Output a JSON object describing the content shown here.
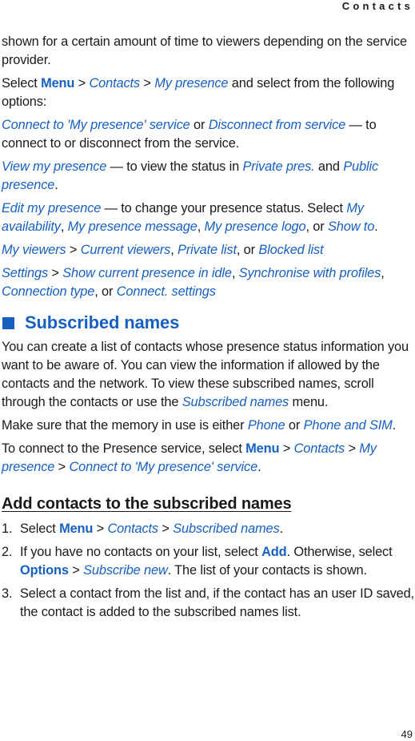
{
  "header": {
    "section_title": "Contacts"
  },
  "intro": {
    "continuation": "shown for a certain amount of time to viewers depending on the service provider.",
    "select_prefix": "Select ",
    "menu": "Menu",
    "sep": " > ",
    "contacts": "Contacts",
    "my_presence": "My presence",
    "select_suffix": " and select from the following options:"
  },
  "options": {
    "connect": {
      "opt1": "Connect to 'My presence' service",
      "or": " or ",
      "opt2": "Disconnect from service",
      "desc": " — to connect to or disconnect from the service."
    },
    "view": {
      "opt": "View my presence",
      "desc": " — to view the status in ",
      "private": "Private pres.",
      "and": " and ",
      "public": "Public presence",
      "end": "."
    },
    "edit": {
      "opt": "Edit my presence",
      "desc": " — to change your presence status. Select ",
      "a": "My availability",
      "comma1": ", ",
      "b": "My presence message",
      "comma2": ", ",
      "c": "My presence logo",
      "or": ", or ",
      "d": "Show to",
      "end": "."
    },
    "viewers": {
      "opt": "My viewers",
      "sep": " > ",
      "a": "Current viewers",
      "comma": ", ",
      "b": "Private list",
      "or": ", or ",
      "c": "Blocked list"
    },
    "settings": {
      "opt": "Settings",
      "sep": " > ",
      "a": "Show current presence in idle",
      "comma1": ", ",
      "b": "Synchronise with profiles",
      "comma2": ", ",
      "c": "Connection type",
      "or": ", or ",
      "d": "Connect. settings"
    }
  },
  "subscribed": {
    "heading": "Subscribed names",
    "para1_prefix": "You can create a list of contacts whose presence status information you want to be aware of. You can view the information if allowed by the contacts and the network. To view these subscribed names, scroll through the contacts or use the ",
    "para1_link": "Subscribed names",
    "para1_suffix": " menu.",
    "para2_prefix": "Make sure that the memory in use is either ",
    "para2_a": "Phone",
    "para2_or": " or ",
    "para2_b": "Phone and SIM",
    "para2_end": ".",
    "para3_prefix": "To connect to the Presence service, select ",
    "para3_menu": "Menu",
    "para3_sep": " > ",
    "para3_contacts": "Contacts",
    "para3_mypresence": "My presence",
    "para3_connect": "Connect to 'My presence' service",
    "para3_end": "."
  },
  "add_contacts": {
    "heading": "Add contacts to the subscribed names",
    "steps": [
      {
        "num": "1.",
        "prefix": "Select ",
        "menu": "Menu",
        "sep": " > ",
        "contacts": "Contacts",
        "names": "Subscribed names",
        "end": "."
      },
      {
        "num": "2.",
        "prefix": "If you have no contacts on your list, select ",
        "add": "Add",
        "mid": ". Otherwise, select ",
        "options": "Options",
        "sep": " > ",
        "subscribe": "Subscribe new",
        "end": ". The list of your contacts is shown."
      },
      {
        "num": "3.",
        "text": "Select a contact from the list and, if the contact has an user ID saved, the contact is added to the subscribed names list."
      }
    ]
  },
  "footer": {
    "page_number": "49"
  },
  "colors": {
    "accent": "#1760c0",
    "text": "#1a1a1a"
  }
}
